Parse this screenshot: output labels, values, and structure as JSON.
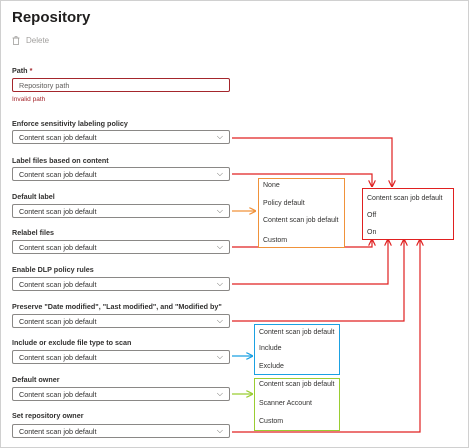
{
  "title": "Repository",
  "toolbar": {
    "delete_label": "Delete"
  },
  "path": {
    "label": "Path",
    "required_mark": "*",
    "placeholder": "Repository path",
    "error": "Invalid path"
  },
  "settings": [
    {
      "label": "Enforce sensitivity labeling policy",
      "value": "Content scan job default"
    },
    {
      "label": "Label files based on content",
      "value": "Content scan job default"
    },
    {
      "label": "Default label",
      "value": "Content scan job default"
    },
    {
      "label": "Relabel files",
      "value": "Content scan job default"
    },
    {
      "label": "Enable DLP policy rules",
      "value": "Content scan job default"
    },
    {
      "label": "Preserve \"Date modified\", \"Last modified\", and \"Modified by\"",
      "value": "Content scan job default"
    },
    {
      "label": "Include or exclude file type to scan",
      "value": "Content scan job default"
    },
    {
      "label": "Default owner",
      "value": "Content scan job default"
    },
    {
      "label": "Set repository owner",
      "value": "Content scan job default"
    }
  ],
  "callouts": {
    "default_label_options": [
      "None",
      "Policy default",
      "Content scan job default",
      "Custom"
    ],
    "toggle_options": [
      "Content scan job default",
      "Off",
      "On"
    ],
    "file_type_options": [
      "Content scan job default",
      "Include",
      "Exclude"
    ],
    "owner_options": [
      "Content scan job default",
      "Scanner Account",
      "Custom"
    ]
  },
  "colors": {
    "red": "#e02020",
    "orange": "#f0923a",
    "blue": "#1ba1e2",
    "green": "#9acd32"
  }
}
